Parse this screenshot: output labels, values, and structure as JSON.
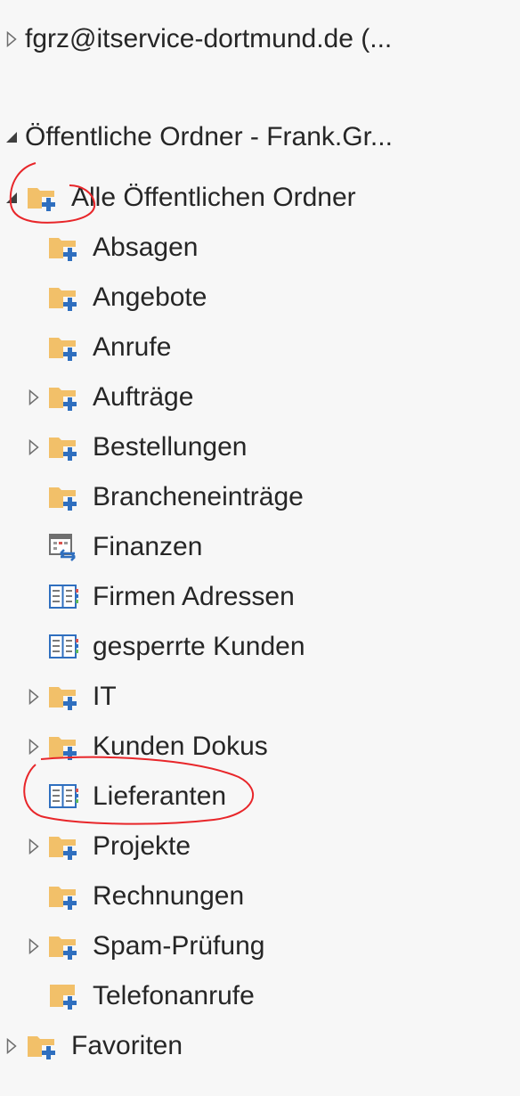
{
  "accounts": {
    "account1": "fgrz@itservice-dortmund.de (...",
    "public_root": "Öffentliche Ordner - Frank.Gr...",
    "favorites": "Favoriten"
  },
  "tree": {
    "all_public": "Alle Öffentlichen Ordner",
    "items": [
      {
        "label": "Absagen",
        "icon": "folder-public-icon",
        "expander": false
      },
      {
        "label": "Angebote",
        "icon": "folder-public-icon",
        "expander": false
      },
      {
        "label": "Anrufe",
        "icon": "folder-public-icon",
        "expander": false
      },
      {
        "label": "Aufträge",
        "icon": "folder-public-icon",
        "expander": true
      },
      {
        "label": "Bestellungen",
        "icon": "folder-public-icon",
        "expander": true
      },
      {
        "label": "Brancheneinträge",
        "icon": "folder-public-icon",
        "expander": false
      },
      {
        "label": "Finanzen",
        "icon": "calendar-public-icon",
        "expander": false
      },
      {
        "label": "Firmen Adressen",
        "icon": "contacts-icon",
        "expander": false
      },
      {
        "label": "gesperrte Kunden",
        "icon": "contacts-icon",
        "expander": false
      },
      {
        "label": "IT",
        "icon": "folder-public-icon",
        "expander": true
      },
      {
        "label": "Kunden Dokus",
        "icon": "folder-public-icon",
        "expander": true
      },
      {
        "label": "Lieferanten",
        "icon": "contacts-icon",
        "expander": false
      },
      {
        "label": "Projekte",
        "icon": "folder-public-icon",
        "expander": true
      },
      {
        "label": "Rechnungen",
        "icon": "folder-public-icon",
        "expander": false
      },
      {
        "label": "Spam-Prüfung",
        "icon": "folder-public-icon",
        "expander": true
      },
      {
        "label": "Telefonanrufe",
        "icon": "note-public-icon",
        "expander": false
      }
    ]
  },
  "colors": {
    "folder": "#f2c069",
    "plus": "#2f6fbf",
    "annotation": "#e8262a",
    "text": "#262626"
  }
}
